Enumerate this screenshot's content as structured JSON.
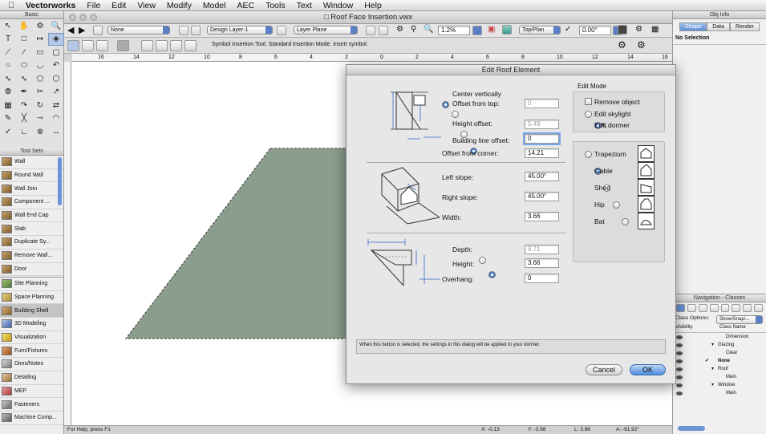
{
  "menubar": {
    "apple": "",
    "app": "Vectorworks",
    "items": [
      "File",
      "Edit",
      "View",
      "Modify",
      "Model",
      "AEC",
      "Tools",
      "Text",
      "Window",
      "Help"
    ]
  },
  "document": {
    "title": "Roof Face Insertion.vwx"
  },
  "toolbar": {
    "class_select": "None",
    "layer_select": "Design Layer-1",
    "plane_select": "Layer Plane",
    "zoom": "1.2%",
    "view_select": "Top/Plan",
    "angle": "0.00°",
    "mode_text": "Symbol Insertion Tool: Standard Insertion Mode. Insert symbol."
  },
  "rulers": {
    "top": [
      "16",
      "14",
      "12",
      "10",
      "8",
      "6",
      "4",
      "2",
      "0",
      "2",
      "4",
      "6",
      "8",
      "10",
      "12",
      "14",
      "16"
    ]
  },
  "palettes": {
    "basic_title": "Basic",
    "toolsets_title": "Tool Sets",
    "tools": [
      {
        "label": "Wall"
      },
      {
        "label": "Round Wall"
      },
      {
        "label": "Wall Join"
      },
      {
        "label": "Component ..."
      },
      {
        "label": "Wall End Cap"
      },
      {
        "label": "Slab"
      },
      {
        "label": "Duplicate Sy..."
      },
      {
        "label": "Remove Wall..."
      },
      {
        "label": "Door"
      }
    ],
    "sets": [
      {
        "label": "Site Planning",
        "selected": false
      },
      {
        "label": "Space Planning",
        "selected": false
      },
      {
        "label": "Building Shell",
        "selected": true
      },
      {
        "label": "3D Modeling",
        "selected": false
      },
      {
        "label": "Visualization",
        "selected": false
      },
      {
        "label": "Furn/Fixtures",
        "selected": false
      },
      {
        "label": "Dims/Notes",
        "selected": false
      },
      {
        "label": "Detailing",
        "selected": false
      },
      {
        "label": "MEP",
        "selected": false
      },
      {
        "label": "Fasteners",
        "selected": false
      },
      {
        "label": "Machine Comp...",
        "selected": false
      }
    ]
  },
  "objinfo": {
    "title": "Obj Info",
    "tabs": [
      "Shape",
      "Data",
      "Render"
    ],
    "active_tab": "Shape",
    "selection": "No Selection"
  },
  "navigation": {
    "title": "Navigation - Classes",
    "class_options_label": "Class Options:",
    "class_options_value": "Show/Snap/...",
    "col_visibility": "Visibility",
    "col_class_name": "Class Name",
    "classes": [
      {
        "name": "Dimension",
        "indent": 3,
        "arrow": false,
        "active": false
      },
      {
        "name": "Glazing",
        "indent": 2,
        "arrow": true,
        "active": false
      },
      {
        "name": "Clear",
        "indent": 3,
        "arrow": false,
        "active": false
      },
      {
        "name": "None",
        "indent": 2,
        "arrow": false,
        "active": true
      },
      {
        "name": "Roof",
        "indent": 2,
        "arrow": true,
        "active": false
      },
      {
        "name": "Main",
        "indent": 3,
        "arrow": false,
        "active": false
      },
      {
        "name": "Window",
        "indent": 2,
        "arrow": true,
        "active": false
      },
      {
        "name": "Main",
        "indent": 3,
        "arrow": false,
        "active": false
      }
    ]
  },
  "dialog": {
    "title": "Edit Roof Element",
    "vertical": {
      "center_label": "Center vertically",
      "offset_top_label": "Offset from top:",
      "offset_top_value": "0",
      "height_offset_label": "Height offset:",
      "height_offset_value": "5.49",
      "building_line_label": "Building line offset:",
      "building_line_value": "0",
      "offset_corner_label": "Offset from corner:",
      "offset_corner_value": "14.21"
    },
    "slopes": {
      "left_label": "Left slope:",
      "left_value": "45.00°",
      "right_label": "Right slope:",
      "right_value": "45.00°",
      "width_label": "Width:",
      "width_value": "3.66"
    },
    "depth": {
      "depth_label": "Depth:",
      "depth_value": "9.71",
      "height_label": "Height:",
      "height_value": "3.66",
      "overhang_label": "Overhang:",
      "overhang_value": "0"
    },
    "edit_mode": {
      "title": "Edit Mode",
      "remove_label": "Remove object",
      "skylight_label": "Edit skylight",
      "dormer_label": "Edit dormer",
      "selected": "dormer"
    },
    "dormer_types": {
      "items": [
        "Trapezium",
        "Gable",
        "Shed",
        "Hip",
        "Bat"
      ],
      "selected": "Gable"
    },
    "help_text": "When this button is selected, the settings in this dialog will be applied to your dormer.",
    "cancel_label": "Cancel",
    "ok_label": "OK"
  },
  "status": {
    "help": "For Help, press F1",
    "x": "X: -0.13",
    "y": "Y: -3.98",
    "l": "L: 3.98",
    "a": "A: -91.92°"
  },
  "colors": {
    "roof_fill": "#8b9e8d",
    "accent": "#3e74c8"
  }
}
